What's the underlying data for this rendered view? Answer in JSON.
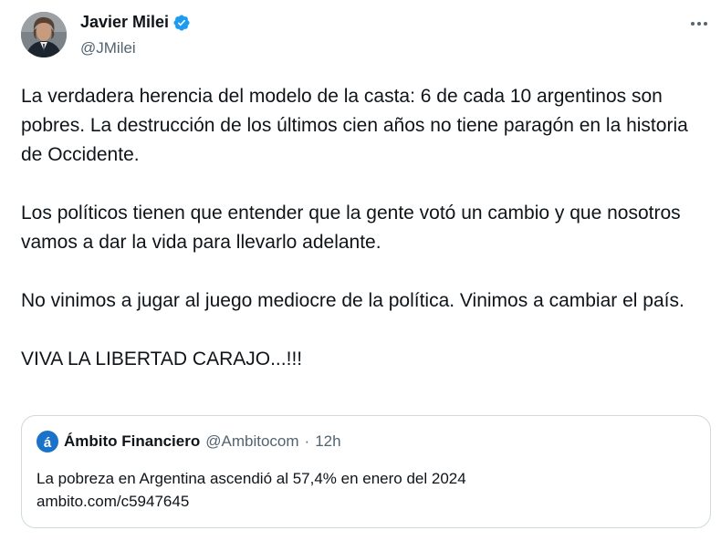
{
  "author": {
    "display_name": "Javier Milei",
    "handle": "@JMilei",
    "verified": true
  },
  "tweet": {
    "paragraphs": [
      "La verdadera herencia del modelo de la casta: 6 de cada 10 argentinos son pobres. La destrucción de los últimos cien años no tiene paragón en la historia de Occidente.",
      "Los políticos tienen que entender que la gente votó un cambio y que nosotros vamos a dar la vida para llevarlo adelante.",
      "No vinimos a jugar al juego mediocre de la política. Vinimos a cambiar el país.",
      "VIVA LA LIBERTAD CARAJO...!!!"
    ]
  },
  "quote": {
    "display_name": "Ámbito Financiero",
    "handle": "@Ambitocom",
    "separator": "·",
    "time": "12h",
    "text": "La pobreza en Argentina ascendió al 57,4% en enero del 2024",
    "link": "ambito.com/c5947645"
  },
  "icons": {
    "verified": "verified-badge-icon",
    "more": "more-options-icon",
    "quote_logo": "ambito-logo-icon"
  },
  "colors": {
    "verified": "#1d9bf0",
    "primary_text": "#0f1419",
    "secondary_text": "#536471",
    "border": "#cfd9de",
    "ambito_brand": "#1a73c9"
  }
}
